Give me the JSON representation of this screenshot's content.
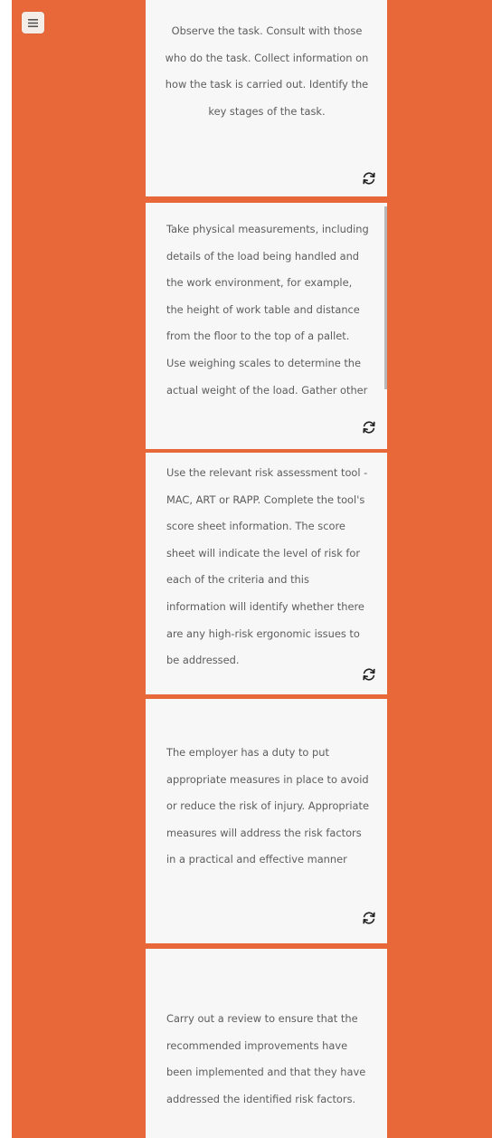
{
  "menu": {
    "icon": "hamburger-menu-icon"
  },
  "cards": [
    {
      "text": "Observe the task. Consult with those who do the task. Collect information on how the task is carried out. Identify the key stages of the task.",
      "flip_icon": "flip-card-icon"
    },
    {
      "text": "Take physical measurements, including details of the load being handled and the work environment, for example, the height of work table and distance from the  floor to the top of a pallet. Use weighing scales to determine the actual weight of the load. Gather other",
      "flip_icon": "flip-card-icon"
    },
    {
      "text": "Use the relevant risk assessment tool - MAC, ART or RAPP.  Complete the tool's score sheet information. The score sheet will indicate the level of risk for each of the criteria and this information will identify whether there are any high-risk ergonomic issues to be addressed.",
      "flip_icon": "flip-card-icon"
    },
    {
      "text": "The employer has a duty to put appropriate measures in place to avoid or reduce the risk of injury. Appropriate measures will address the risk factors in a practical and effective manner",
      "flip_icon": "flip-card-icon"
    },
    {
      "text": "Carry out a review to ensure that the recommended improvements have been implemented and that they have addressed the identified risk factors.",
      "flip_icon": "flip-card-icon"
    }
  ],
  "colors": {
    "background": "#e8683a",
    "card": "#f7f7f7",
    "text": "#5d5d5d"
  }
}
